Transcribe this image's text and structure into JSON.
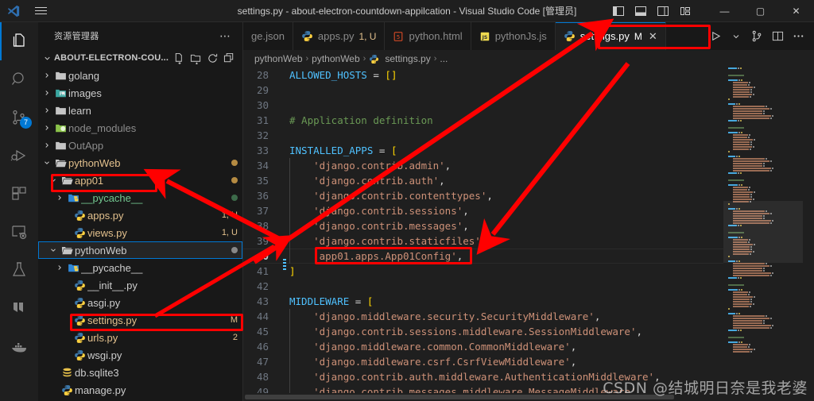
{
  "window": {
    "title": "settings.py - about-electron-countdown-appilcation - Visual Studio Code [管理员]",
    "minimize": "—",
    "maximize": "▢",
    "close": "✕"
  },
  "activitybar": {
    "items": [
      {
        "name": "explorer-icon",
        "label": "Explorer",
        "active": true,
        "badge": ""
      },
      {
        "name": "search-icon",
        "label": "Search",
        "active": false,
        "badge": ""
      },
      {
        "name": "source-control-icon",
        "label": "Source Control",
        "active": false,
        "badge": "7"
      },
      {
        "name": "run-debug-icon",
        "label": "Run and Debug",
        "active": false,
        "badge": ""
      },
      {
        "name": "extensions-icon",
        "label": "Extensions",
        "active": false,
        "badge": ""
      },
      {
        "name": "remote-explorer-icon",
        "label": "Remote Explorer",
        "active": false,
        "badge": ""
      },
      {
        "name": "testing-icon",
        "label": "Testing",
        "active": false,
        "badge": ""
      },
      {
        "name": "bookmarks-icon",
        "label": "Bookmarks",
        "active": false,
        "badge": ""
      },
      {
        "name": "docker-icon",
        "label": "Docker",
        "active": false,
        "badge": ""
      }
    ]
  },
  "sidebar": {
    "title": "资源管理器",
    "more_actions": "⋯",
    "section": {
      "name": "ABOUT-ELECTRON-COU...",
      "actions": [
        "new-file-icon",
        "new-folder-icon",
        "refresh-icon",
        "collapse-all-icon"
      ]
    },
    "tree": [
      {
        "label": "golang",
        "indent": 1,
        "type": "folder",
        "expanded": false,
        "badge": "",
        "dot": "",
        "color": "normal"
      },
      {
        "label": "images",
        "indent": 1,
        "type": "folder-images",
        "expanded": false,
        "badge": "",
        "dot": "",
        "color": "normal"
      },
      {
        "label": "learn",
        "indent": 1,
        "type": "folder",
        "expanded": false,
        "badge": "",
        "dot": "",
        "color": "normal"
      },
      {
        "label": "node_modules",
        "indent": 1,
        "type": "folder-node",
        "expanded": false,
        "badge": "",
        "dot": "",
        "color": "dim"
      },
      {
        "label": "OutApp",
        "indent": 1,
        "type": "folder",
        "expanded": false,
        "badge": "",
        "dot": "",
        "color": "dim"
      },
      {
        "label": "pythonWeb",
        "indent": 1,
        "type": "folder-open",
        "expanded": true,
        "badge": "",
        "dot": "amber",
        "color": "amber"
      },
      {
        "label": "app01",
        "indent": 2,
        "type": "folder-open",
        "expanded": true,
        "badge": "",
        "dot": "amber",
        "color": "amber"
      },
      {
        "label": "__pycache__",
        "indent": 3,
        "type": "folder-py",
        "expanded": false,
        "badge": "",
        "dot": "green",
        "color": "green"
      },
      {
        "label": "apps.py",
        "indent": 4,
        "type": "python",
        "expanded": null,
        "badge": "1, U",
        "dot": "",
        "color": "amber"
      },
      {
        "label": "views.py",
        "indent": 4,
        "type": "python",
        "expanded": null,
        "badge": "1, U",
        "dot": "",
        "color": "amber"
      },
      {
        "label": "pythonWeb",
        "indent": 2,
        "type": "folder-open",
        "expanded": true,
        "badge": "",
        "dot": "grey",
        "color": "normal",
        "selected": true
      },
      {
        "label": "__pycache__",
        "indent": 3,
        "type": "folder-py",
        "expanded": false,
        "badge": "",
        "dot": "",
        "color": "normal"
      },
      {
        "label": "__init__.py",
        "indent": 4,
        "type": "python",
        "expanded": null,
        "badge": "",
        "dot": "",
        "color": "normal"
      },
      {
        "label": "asgi.py",
        "indent": 4,
        "type": "python",
        "expanded": null,
        "badge": "",
        "dot": "",
        "color": "normal"
      },
      {
        "label": "settings.py",
        "indent": 4,
        "type": "python",
        "expanded": null,
        "badge": "M",
        "dot": "",
        "color": "amber"
      },
      {
        "label": "urls.py",
        "indent": 4,
        "type": "python",
        "expanded": null,
        "badge": "2",
        "dot": "",
        "color": "amber"
      },
      {
        "label": "wsgi.py",
        "indent": 4,
        "type": "python",
        "expanded": null,
        "badge": "",
        "dot": "",
        "color": "normal"
      },
      {
        "label": "db.sqlite3",
        "indent": 2,
        "type": "database",
        "expanded": null,
        "badge": "",
        "dot": "",
        "color": "normal"
      },
      {
        "label": "manage.py",
        "indent": 2,
        "type": "python",
        "expanded": null,
        "badge": "",
        "dot": "",
        "color": "normal"
      }
    ]
  },
  "editor": {
    "tabs": [
      {
        "name": "ge.json",
        "icon": "",
        "badge": "",
        "active": false,
        "dirty": false,
        "close": ""
      },
      {
        "name": "apps.py",
        "icon": "python-icon",
        "badge": "1, U",
        "active": false,
        "dirty": false,
        "close": ""
      },
      {
        "name": "python.html",
        "icon": "html-icon",
        "badge": "",
        "active": false,
        "dirty": false,
        "close": ""
      },
      {
        "name": "pythonJs.js",
        "icon": "js-icon",
        "badge": "",
        "active": false,
        "dirty": false,
        "close": ""
      },
      {
        "name": "settings.py",
        "icon": "python-icon",
        "badge": "M",
        "active": true,
        "dirty": true,
        "close": "✕"
      }
    ],
    "tab_actions": [
      "run-icon",
      "chevron-down-icon",
      "split-editor-icon",
      "layout-icon",
      "more-icon"
    ],
    "breadcrumb": [
      "pythonWeb",
      "pythonWeb",
      "settings.py",
      "..."
    ],
    "breadcrumb_sep": "›",
    "lines": [
      {
        "num": "28",
        "tokens": [
          {
            "t": "ALLOWED_HOSTS",
            "c": "kw"
          },
          {
            "t": " = ",
            "c": "op"
          },
          {
            "t": "[]",
            "c": "brk"
          }
        ],
        "indent": 0
      },
      {
        "num": "29",
        "tokens": [],
        "indent": 0
      },
      {
        "num": "30",
        "tokens": [],
        "indent": 0
      },
      {
        "num": "31",
        "tokens": [
          {
            "t": "# Application definition",
            "c": "cmt"
          }
        ],
        "indent": 0
      },
      {
        "num": "32",
        "tokens": [],
        "indent": 0
      },
      {
        "num": "33",
        "tokens": [
          {
            "t": "INSTALLED_APPS",
            "c": "kw"
          },
          {
            "t": " = ",
            "c": "op"
          },
          {
            "t": "[",
            "c": "brk"
          }
        ],
        "indent": 0
      },
      {
        "num": "34",
        "tokens": [
          {
            "t": "    'django.contrib.admin'",
            "c": "str"
          },
          {
            "t": ",",
            "c": "pun"
          }
        ],
        "indent": 1
      },
      {
        "num": "35",
        "tokens": [
          {
            "t": "    'django.contrib.auth'",
            "c": "str"
          },
          {
            "t": ",",
            "c": "pun"
          }
        ],
        "indent": 1
      },
      {
        "num": "36",
        "tokens": [
          {
            "t": "    'django.contrib.contenttypes'",
            "c": "str"
          },
          {
            "t": ",",
            "c": "pun"
          }
        ],
        "indent": 1
      },
      {
        "num": "37",
        "tokens": [
          {
            "t": "    'django.contrib.sessions'",
            "c": "str"
          },
          {
            "t": ",",
            "c": "pun"
          }
        ],
        "indent": 1
      },
      {
        "num": "38",
        "tokens": [
          {
            "t": "    'django.contrib.messages'",
            "c": "str"
          },
          {
            "t": ",",
            "c": "pun"
          }
        ],
        "indent": 1
      },
      {
        "num": "39",
        "tokens": [
          {
            "t": "    'django.contrib.staticfiles'",
            "c": "str"
          },
          {
            "t": ",",
            "c": "pun"
          }
        ],
        "indent": 1
      },
      {
        "num": "40",
        "tokens": [
          {
            "t": "    'app01.apps.App01Config'",
            "c": "str"
          },
          {
            "t": ",",
            "c": "pun"
          }
        ],
        "indent": 1,
        "current": true
      },
      {
        "num": "41",
        "tokens": [
          {
            "t": "]",
            "c": "brk"
          }
        ],
        "indent": 0
      },
      {
        "num": "42",
        "tokens": [],
        "indent": 0
      },
      {
        "num": "43",
        "tokens": [
          {
            "t": "MIDDLEWARE",
            "c": "kw"
          },
          {
            "t": " = ",
            "c": "op"
          },
          {
            "t": "[",
            "c": "brk"
          }
        ],
        "indent": 0
      },
      {
        "num": "44",
        "tokens": [
          {
            "t": "    'django.middleware.security.SecurityMiddleware'",
            "c": "str"
          },
          {
            "t": ",",
            "c": "pun"
          }
        ],
        "indent": 1
      },
      {
        "num": "45",
        "tokens": [
          {
            "t": "    'django.contrib.sessions.middleware.SessionMiddleware'",
            "c": "str"
          },
          {
            "t": ",",
            "c": "pun"
          }
        ],
        "indent": 1
      },
      {
        "num": "46",
        "tokens": [
          {
            "t": "    'django.middleware.common.CommonMiddleware'",
            "c": "str"
          },
          {
            "t": ",",
            "c": "pun"
          }
        ],
        "indent": 1
      },
      {
        "num": "47",
        "tokens": [
          {
            "t": "    'django.middleware.csrf.CsrfViewMiddleware'",
            "c": "str"
          },
          {
            "t": ",",
            "c": "pun"
          }
        ],
        "indent": 1
      },
      {
        "num": "48",
        "tokens": [
          {
            "t": "    'django.contrib.auth.middleware.AuthenticationMiddleware'",
            "c": "str"
          },
          {
            "t": ",",
            "c": "pun"
          }
        ],
        "indent": 1
      },
      {
        "num": "49",
        "tokens": [
          {
            "t": "    'django.contrib.messages.middleware.MessageMiddleware'",
            "c": "str"
          },
          {
            "t": ",",
            "c": "pun"
          }
        ],
        "indent": 1
      }
    ]
  },
  "annotations": {
    "watermark": "CSDN @结城明日奈是我老婆",
    "highlight_color": "#ff0000",
    "boxes": [
      {
        "name": "settings-tab-highlight"
      },
      {
        "name": "app01-folder-highlight"
      },
      {
        "name": "settings-file-highlight"
      },
      {
        "name": "installed-app-line-highlight"
      }
    ]
  }
}
